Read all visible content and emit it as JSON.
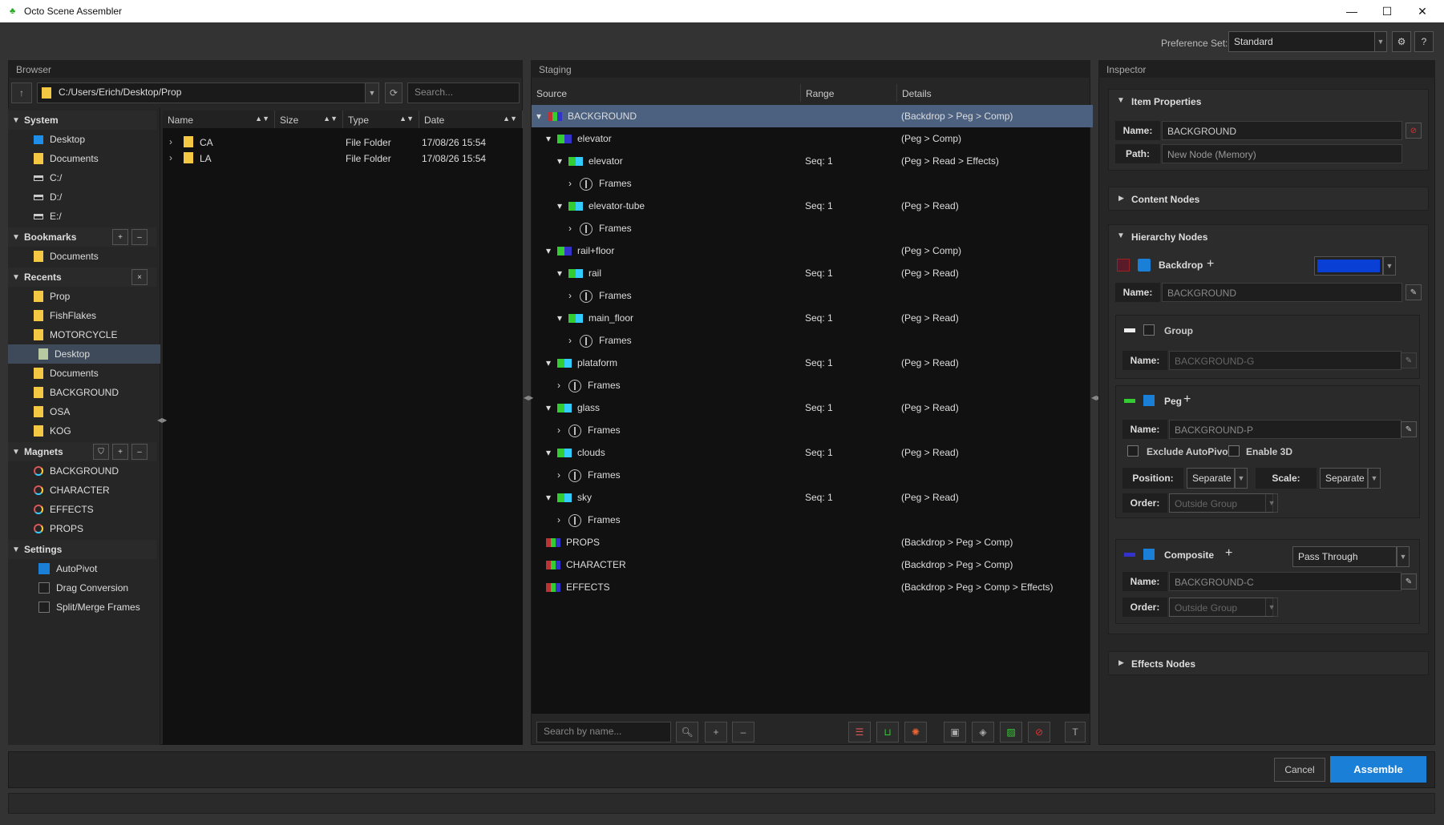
{
  "window": {
    "title": "Octo Scene Assembler"
  },
  "preference": {
    "label": "Preference Set:",
    "value": "Standard"
  },
  "browser": {
    "title": "Browser",
    "path": "C:/Users/Erich/Desktop/Prop",
    "search_placeholder": "Search...",
    "sections": {
      "system": {
        "label": "System",
        "items": [
          "Desktop",
          "Documents",
          "C:/",
          "D:/",
          "E:/"
        ]
      },
      "bookmarks": {
        "label": "Bookmarks",
        "items": [
          "Documents"
        ]
      },
      "recents": {
        "label": "Recents",
        "items": [
          "Prop",
          "FishFlakes",
          "MOTORCYCLE",
          "Desktop",
          "Documents",
          "BACKGROUND",
          "OSA",
          "KOG"
        ]
      },
      "magnets": {
        "label": "Magnets",
        "items": [
          "BACKGROUND",
          "CHARACTER",
          "EFFECTS",
          "PROPS"
        ]
      },
      "settings": {
        "label": "Settings",
        "items": [
          "AutoPivot",
          "Drag Conversion",
          "Split/Merge Frames"
        ],
        "checked": [
          true,
          false,
          false
        ]
      }
    },
    "file_columns": [
      "Name",
      "Size",
      "Type",
      "Date"
    ],
    "files": [
      {
        "name": "CA",
        "size": "",
        "type": "File Folder",
        "date": "17/08/26 15:54"
      },
      {
        "name": "LA",
        "size": "",
        "type": "File Folder",
        "date": "17/08/26 15:54"
      }
    ]
  },
  "staging": {
    "title": "Staging",
    "columns": [
      "Source",
      "Range",
      "Details"
    ],
    "rows": [
      {
        "name": "BACKGROUND",
        "range": "",
        "details": "(Backdrop > Peg > Comp)"
      },
      {
        "name": "elevator",
        "range": "",
        "details": "(Peg > Comp)"
      },
      {
        "name": "elevator",
        "range": "Seq: 1",
        "details": "(Peg > Read > Effects)"
      },
      {
        "name": "Frames",
        "range": "",
        "details": ""
      },
      {
        "name": "elevator-tube",
        "range": "Seq: 1",
        "details": "(Peg > Read)"
      },
      {
        "name": "Frames",
        "range": "",
        "details": ""
      },
      {
        "name": "rail+floor",
        "range": "",
        "details": "(Peg > Comp)"
      },
      {
        "name": "rail",
        "range": "Seq: 1",
        "details": "(Peg > Read)"
      },
      {
        "name": "Frames",
        "range": "",
        "details": ""
      },
      {
        "name": "main_floor",
        "range": "Seq: 1",
        "details": "(Peg > Read)"
      },
      {
        "name": "Frames",
        "range": "",
        "details": ""
      },
      {
        "name": "plataform",
        "range": "Seq: 1",
        "details": "(Peg > Read)"
      },
      {
        "name": "Frames",
        "range": "",
        "details": ""
      },
      {
        "name": "glass",
        "range": "Seq: 1",
        "details": "(Peg > Read)"
      },
      {
        "name": "Frames",
        "range": "",
        "details": ""
      },
      {
        "name": "clouds",
        "range": "Seq: 1",
        "details": "(Peg > Read)"
      },
      {
        "name": "Frames",
        "range": "",
        "details": ""
      },
      {
        "name": "sky",
        "range": "Seq: 1",
        "details": "(Peg > Read)"
      },
      {
        "name": "Frames",
        "range": "",
        "details": ""
      },
      {
        "name": "PROPS",
        "range": "",
        "details": "(Backdrop > Peg > Comp)"
      },
      {
        "name": "CHARACTER",
        "range": "",
        "details": "(Backdrop > Peg > Comp)"
      },
      {
        "name": "EFFECTS",
        "range": "",
        "details": "(Backdrop > Peg > Comp > Effects)"
      }
    ],
    "search_placeholder": "Search by name..."
  },
  "inspector": {
    "title": "Inspector",
    "item_properties": {
      "title": "Item Properties",
      "name_label": "Name:",
      "name_value": "BACKGROUND",
      "path_label": "Path:",
      "path_value": "New Node (Memory)"
    },
    "content_nodes": {
      "title": "Content Nodes"
    },
    "hierarchy_nodes": {
      "title": "Hierarchy Nodes",
      "backdrop": {
        "label": "Backdrop",
        "name_label": "Name:",
        "name_value": "BACKGROUND",
        "color": "#0a3fd6"
      },
      "group": {
        "label": "Group",
        "name_label": "Name:",
        "name_value": "BACKGROUND-G"
      },
      "peg": {
        "label": "Peg",
        "name_label": "Name:",
        "name_value": "BACKGROUND-P",
        "exclude_autopivot": "Exclude AutoPivot",
        "enable_3d": "Enable 3D",
        "position_label": "Position:",
        "position_value": "Separate",
        "scale_label": "Scale:",
        "scale_value": "Separate",
        "order_label": "Order:",
        "order_value": "Outside Group"
      },
      "composite": {
        "label": "Composite",
        "mode": "Pass Through",
        "name_label": "Name:",
        "name_value": "BACKGROUND-C",
        "order_label": "Order:",
        "order_value": "Outside Group"
      }
    },
    "effects_nodes": {
      "title": "Effects Nodes"
    }
  },
  "footer": {
    "cancel": "Cancel",
    "assemble": "Assemble"
  }
}
